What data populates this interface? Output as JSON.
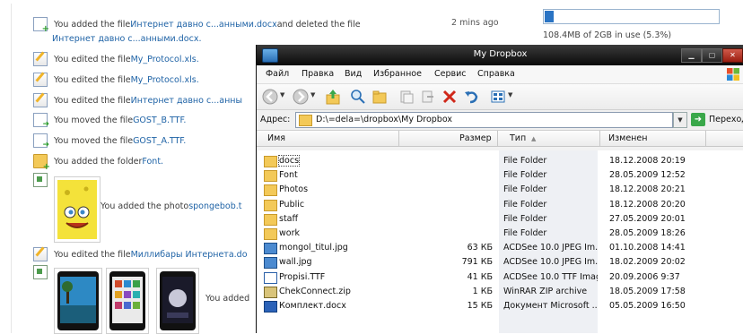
{
  "feed": {
    "events": [
      {
        "prefix": "You added the file ",
        "link": "Интернет давно с...анными.docx",
        "suffix": " and deleted the file",
        "icon": "file-add-icon"
      },
      {
        "prefix": "",
        "link": "Интернет давно с...анными.docx.",
        "suffix": "",
        "icon": ""
      },
      {
        "prefix": "You edited the file ",
        "link": "My_Protocol.xls.",
        "suffix": "",
        "icon": "file-edit-icon"
      },
      {
        "prefix": "You edited the file ",
        "link": "My_Protocol.xls.",
        "suffix": "",
        "icon": "file-edit-icon"
      },
      {
        "prefix": "You edited the file ",
        "link": "Интернет давно с...анны",
        "suffix": "",
        "icon": "file-edit-icon"
      },
      {
        "prefix": "You moved the file ",
        "link": "GOST_B.TTF.",
        "suffix": "",
        "icon": "file-move-icon"
      },
      {
        "prefix": "You moved the file ",
        "link": "GOST_A.TTF.",
        "suffix": "",
        "icon": "file-move-icon"
      },
      {
        "prefix": "You added the folder ",
        "link": "Font.",
        "suffix": "",
        "icon": "folder-add-icon"
      }
    ],
    "photo_event": {
      "prefix": "You added the photo ",
      "link": "spongebob.t"
    },
    "edited_event": {
      "prefix": "You edited the file ",
      "link": "Миллибары Интернета.do"
    },
    "last_event": {
      "prefix": "You added"
    },
    "time": "2 mins ago",
    "quota": {
      "text": "108.4MB of 2GB in use (5.3%)",
      "fraction": 0.053
    }
  },
  "window": {
    "title": "My Dropbox",
    "menu": [
      "Файл",
      "Правка",
      "Вид",
      "Избранное",
      "Сервис",
      "Справка"
    ],
    "address_label": "Адрес:",
    "address_value": "D:\\=dela=\\dropbox\\My Dropbox",
    "go_label": "Переход",
    "columns": {
      "name": "Имя",
      "size": "Размер",
      "type": "Тип",
      "modified": "Изменен"
    },
    "files": [
      {
        "name": "docs",
        "size": "",
        "type": "File Folder",
        "modified": "18.12.2008 20:19",
        "kind": "folder"
      },
      {
        "name": "Font",
        "size": "",
        "type": "File Folder",
        "modified": "28.05.2009 12:52",
        "kind": "folder"
      },
      {
        "name": "Photos",
        "size": "",
        "type": "File Folder",
        "modified": "18.12.2008 20:21",
        "kind": "folder"
      },
      {
        "name": "Public",
        "size": "",
        "type": "File Folder",
        "modified": "18.12.2008 20:20",
        "kind": "folder"
      },
      {
        "name": "staff",
        "size": "",
        "type": "File Folder",
        "modified": "27.05.2009 20:01",
        "kind": "folder"
      },
      {
        "name": "work",
        "size": "",
        "type": "File Folder",
        "modified": "28.05.2009 18:26",
        "kind": "folder"
      },
      {
        "name": "mongol_titul.jpg",
        "size": "63 КБ",
        "type": "ACDSee 10.0 JPEG Im...",
        "modified": "01.10.2008 14:41",
        "kind": "jpg"
      },
      {
        "name": "wall.jpg",
        "size": "791 КБ",
        "type": "ACDSee 10.0 JPEG Im...",
        "modified": "18.02.2009 20:02",
        "kind": "jpg"
      },
      {
        "name": "Propisi.TTF",
        "size": "41 КБ",
        "type": "ACDSee 10.0 TTF Image",
        "modified": "20.09.2006 9:37",
        "kind": "ttf"
      },
      {
        "name": "ChekConnect.zip",
        "size": "1 КБ",
        "type": "WinRAR ZIP archive",
        "modified": "18.05.2009 17:58",
        "kind": "zip"
      },
      {
        "name": "Комплект.docx",
        "size": "15 КБ",
        "type": "Документ Microsoft ...",
        "modified": "05.05.2009 16:50",
        "kind": "doc"
      }
    ]
  },
  "colors": {
    "link": "#1f63a6",
    "quota_fill": "#2a74c4",
    "titlebar": "#0a0a0a"
  }
}
